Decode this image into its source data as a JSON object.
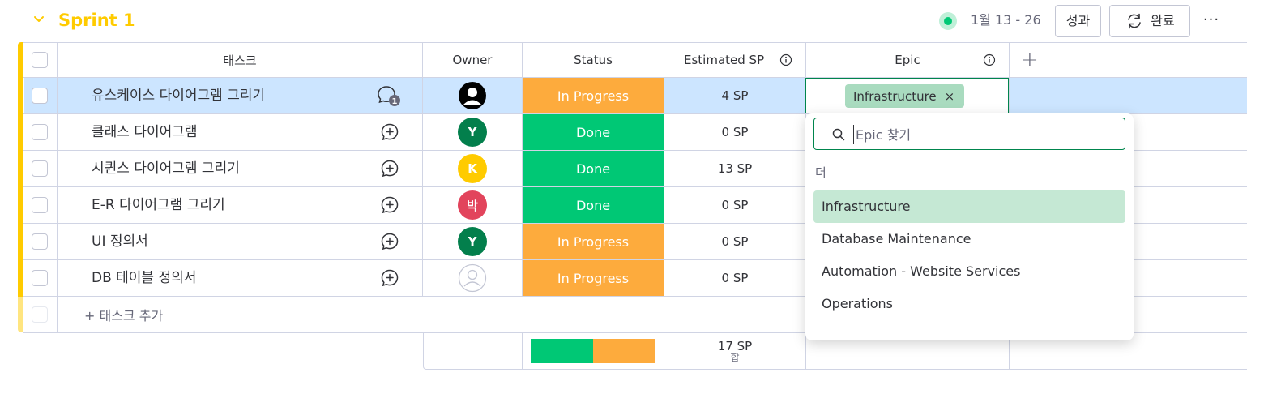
{
  "header": {
    "group_title": "Sprint 1",
    "date_range": "1월 13 - 26",
    "perf_button": "성과",
    "complete_button": "완료",
    "more": "···"
  },
  "columns": {
    "task": "태스크",
    "owner": "Owner",
    "status": "Status",
    "estimated_sp": "Estimated SP",
    "epic": "Epic",
    "add": "+"
  },
  "rows": [
    {
      "task": "유스케이스 다이어그램 그리기",
      "owner_initial": "",
      "owner_type": "user-photo",
      "status": "In Progress",
      "sp": "4 SP",
      "comment_count": "1",
      "selected": true
    },
    {
      "task": "클래스 다이어그램",
      "owner_initial": "Y",
      "owner_type": "initial",
      "status": "Done",
      "sp": "0 SP"
    },
    {
      "task": "시퀀스 다이어그램 그리기",
      "owner_initial": "K",
      "owner_type": "initial",
      "status": "Done",
      "sp": "13 SP"
    },
    {
      "task": "E-R 다이어그램 그리기",
      "owner_initial": "박",
      "owner_type": "initial",
      "status": "Done",
      "sp": "0 SP"
    },
    {
      "task": "UI 정의서",
      "owner_initial": "Y",
      "owner_type": "initial",
      "status": "In Progress",
      "sp": "0 SP"
    },
    {
      "task": "DB 테이블 정의서",
      "owner_initial": "",
      "owner_type": "empty",
      "status": "In Progress",
      "sp": "0 SP"
    }
  ],
  "add_task": "+ 태스크 추가",
  "summary": {
    "sp_total": "17 SP",
    "sp_caption": "합",
    "done_fraction": 0.5,
    "in_progress_fraction": 0.5
  },
  "epic_cell": {
    "chip": "Infrastructure",
    "chip_remove": "×"
  },
  "epic_dropdown": {
    "search_placeholder": "Epic 찾기",
    "section": "더",
    "options": [
      "Infrastructure",
      "Database Maintenance",
      "Automation - Website Services",
      "Operations"
    ]
  },
  "colors": {
    "group": "#ffcb00",
    "done": "#00c875",
    "in_progress": "#fdab3d",
    "selected_row": "#cce5ff",
    "epic_chip": "#a9dbbf",
    "owner_y": "#037f4c",
    "owner_k": "#ffcb00",
    "owner_park": "#e2445c"
  }
}
